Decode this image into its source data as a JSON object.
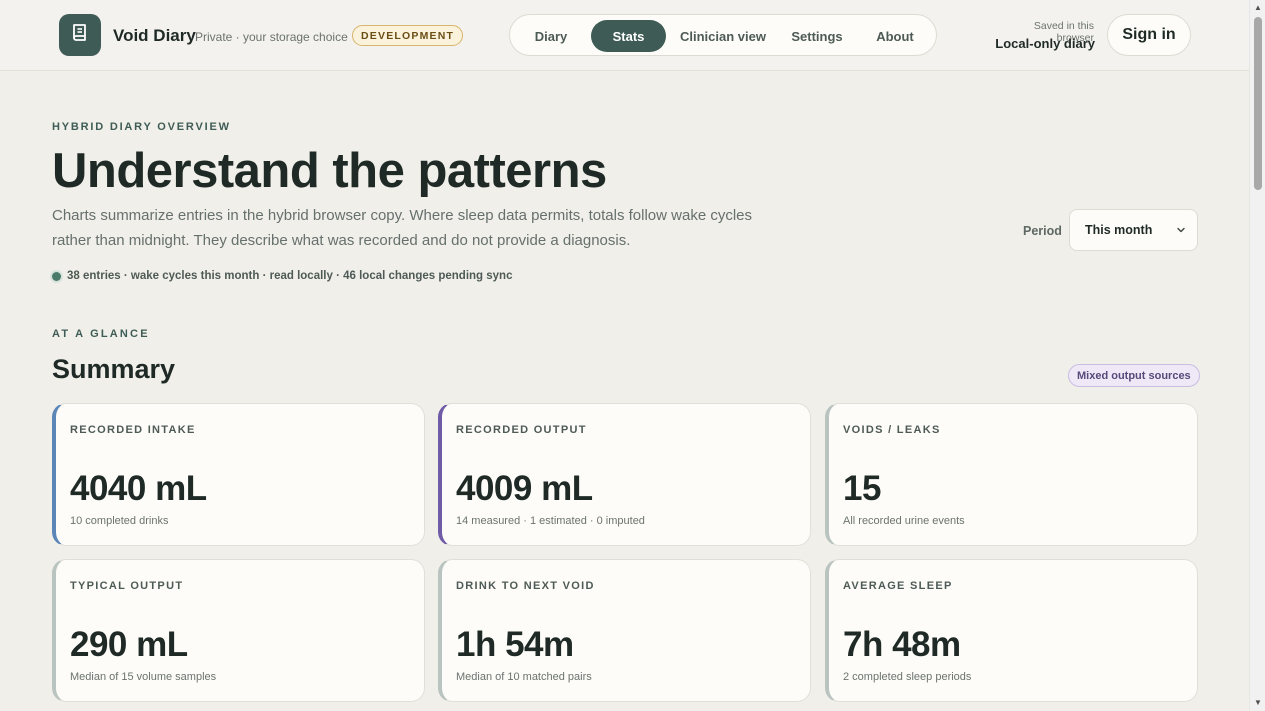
{
  "header": {
    "app_name": "Void Diary",
    "tagline": "Private · your storage choice",
    "env_badge": "DEVELOPMENT",
    "nav": [
      {
        "label": "Diary",
        "active": false
      },
      {
        "label": "Stats",
        "active": true
      },
      {
        "label": "Clinician view",
        "active": false
      },
      {
        "label": "Settings",
        "active": false
      },
      {
        "label": "About",
        "active": false
      }
    ],
    "storage_caption": "Saved in this browser",
    "storage_mode": "Local-only diary",
    "sign_in_label": "Sign in"
  },
  "hero": {
    "eyebrow": "HYBRID DIARY OVERVIEW",
    "title": "Understand the patterns",
    "description": "Charts summarize entries in the hybrid browser copy. Where sleep data permits, totals follow wake cycles rather than midnight. They describe what was recorded and do not provide a diagnosis.",
    "status": "38 entries · wake cycles this month · read locally  · 46 local changes pending sync",
    "period_label": "Period",
    "period_value": "This month"
  },
  "summary": {
    "eyebrow": "AT A GLANCE",
    "title": "Summary",
    "badge": "Mixed output sources",
    "cards": [
      {
        "label": "RECORDED INTAKE",
        "value": "4040 mL",
        "sub": "10 completed drinks",
        "accent": "#5b86b8"
      },
      {
        "label": "RECORDED OUTPUT",
        "value": "4009 mL",
        "sub": "14 measured · 1 estimated · 0 imputed",
        "accent": "#6f5ba6"
      },
      {
        "label": "VOIDS / LEAKS",
        "value": "15",
        "sub": "All recorded urine events",
        "accent": "#b9c3bf"
      },
      {
        "label": "TYPICAL OUTPUT",
        "value": "290 mL",
        "sub": "Median of 15 volume samples",
        "accent": "#b9c3bf"
      },
      {
        "label": "DRINK TO NEXT VOID",
        "value": "1h 54m",
        "sub": "Median of 10 matched pairs",
        "accent": "#b9c3bf"
      },
      {
        "label": "AVERAGE SLEEP",
        "value": "7h 48m",
        "sub": "2 completed sleep periods",
        "accent": "#b9c3bf"
      }
    ]
  },
  "colors": {
    "brand": "#3e5c55",
    "background": "#f1efea",
    "card": "#fdfcf8"
  },
  "icons": {
    "logo": "book-icon",
    "period_dropdown": "chevron-down-icon",
    "status": "status-dot-icon"
  }
}
